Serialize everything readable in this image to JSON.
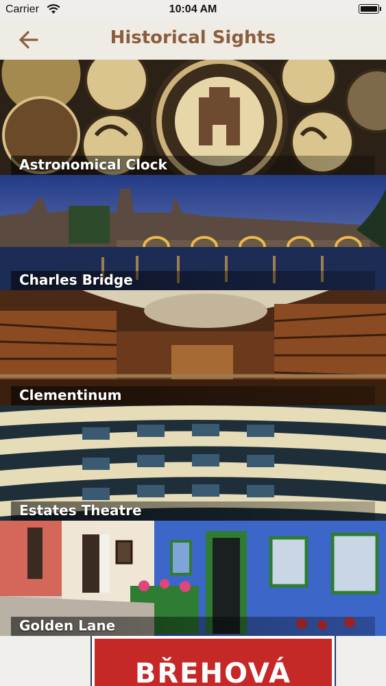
{
  "status_bar": {
    "carrier": "Carrier",
    "time": "10:04 AM"
  },
  "nav": {
    "title": "Historical Sights",
    "back_icon": "arrow-left-icon",
    "title_color": "#8b5e3c"
  },
  "sights": [
    {
      "label": "Astronomical Clock"
    },
    {
      "label": "Charles Bridge"
    },
    {
      "label": "Clementinum"
    },
    {
      "label": "Estates Theatre"
    },
    {
      "label": "Golden Lane"
    }
  ],
  "partial_item": {
    "sign_text": "BŘEHOVÁ"
  }
}
